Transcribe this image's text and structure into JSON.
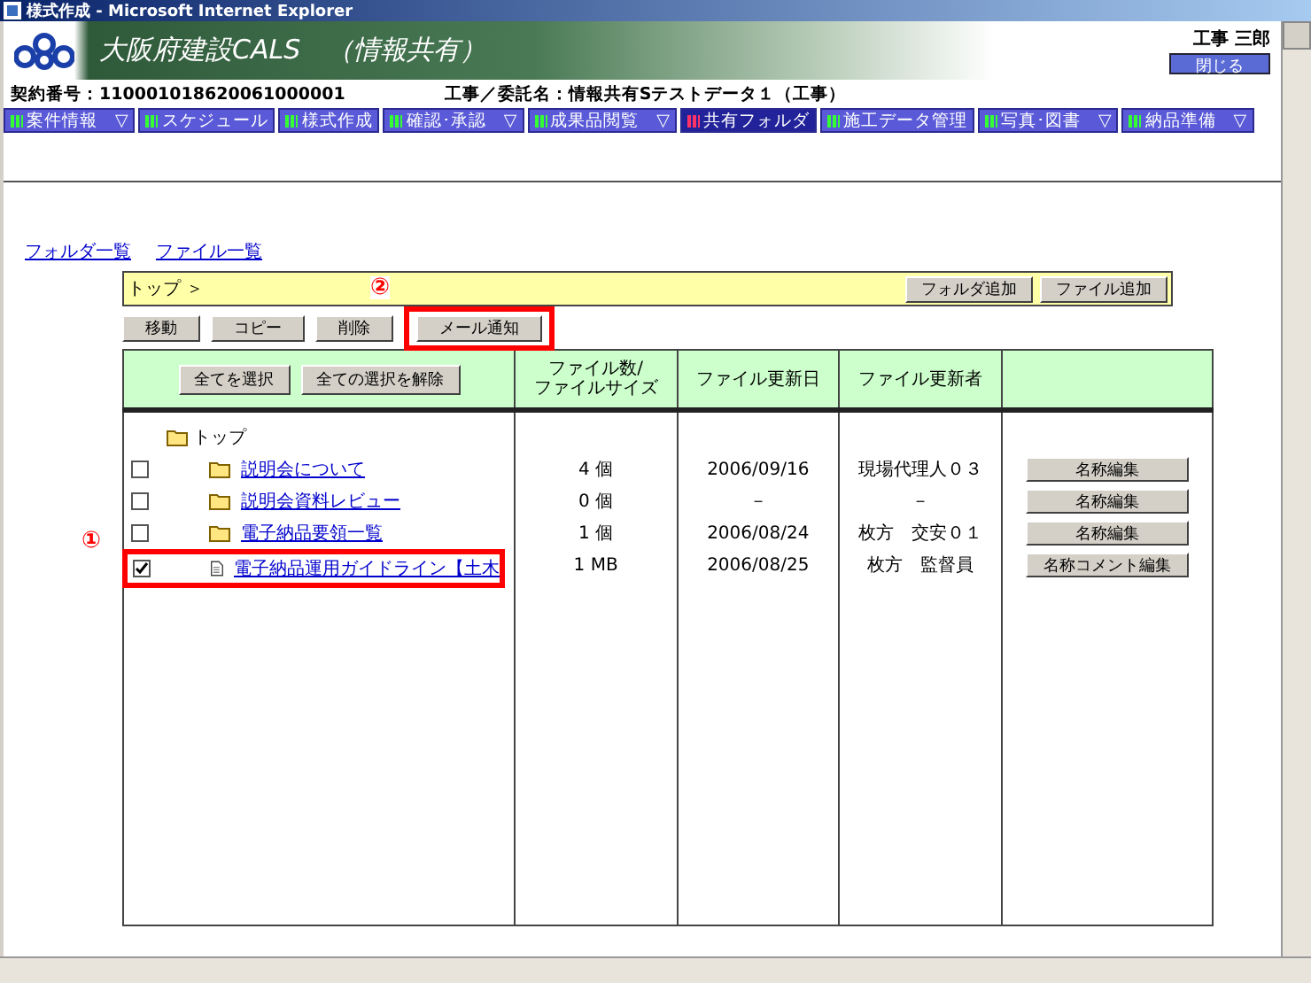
{
  "window": {
    "title": "様式作成 - Microsoft Internet Explorer"
  },
  "header": {
    "site_title": "大阪府建設CALS　（情報共有）",
    "user": "工事 三郎",
    "close_button": "閉じる"
  },
  "contract": {
    "number": "契約番号：110001018620061000001",
    "name": "工事／委託名：情報共有Sテストデータ１（工事）"
  },
  "nav": [
    {
      "label": "案件情報",
      "caret": "▽",
      "selected": false
    },
    {
      "label": "スケジュール",
      "selected": false
    },
    {
      "label": "様式作成",
      "selected": false
    },
    {
      "label": "確認･承認",
      "caret": "▽",
      "selected": false
    },
    {
      "label": "成果品閲覧",
      "caret": "▽",
      "selected": false
    },
    {
      "label": "共有フォルダ",
      "selected": true
    },
    {
      "label": "施工データ管理",
      "selected": false
    },
    {
      "label": "写真･図書",
      "caret": "▽",
      "selected": false
    },
    {
      "label": "納品準備",
      "caret": "▽",
      "selected": false
    }
  ],
  "links": [
    "フォルダ一覧",
    "ファイル一覧"
  ],
  "breadcrumb": "トップ ＞",
  "breadcrumb_buttons": [
    "フォルダ追加",
    "ファイル追加"
  ],
  "callouts": [
    "②",
    "①"
  ],
  "actions": [
    {
      "label": "移動",
      "highlighted": false
    },
    {
      "label": "コピー",
      "highlighted": false
    },
    {
      "label": "削除",
      "highlighted": false
    },
    {
      "label": "メール通知",
      "highlighted": true
    }
  ],
  "table": {
    "select_all": "全てを選択",
    "deselect_all": "全ての選択を解除",
    "columns": [
      "ファイル数/\nファイルサイズ",
      "ファイル更新日",
      "ファイル更新者"
    ],
    "root": "トップ",
    "rows": [
      {
        "kind": "folder",
        "name": "説明会について",
        "checked": false,
        "highlighted": false,
        "count": "4 個",
        "date": "2006/09/16",
        "updater": "現場代理人０３",
        "button": "名称編集"
      },
      {
        "kind": "folder",
        "name": "説明会資料レビュー",
        "checked": false,
        "highlighted": false,
        "count": "0 個",
        "date": "－",
        "updater": "－",
        "button": "名称編集"
      },
      {
        "kind": "folder",
        "name": "電子納品要領一覧",
        "checked": false,
        "highlighted": false,
        "count": "1 個",
        "date": "2006/08/24",
        "updater": "枚方　交安０１",
        "button": "名称編集"
      },
      {
        "kind": "file",
        "name": "電子納品運用ガイドライン【土木",
        "checked": true,
        "highlighted": true,
        "count": "1 MB",
        "date": "2006/08/25",
        "updater": "枚方　監督員",
        "button": "名称コメント編集"
      }
    ]
  }
}
